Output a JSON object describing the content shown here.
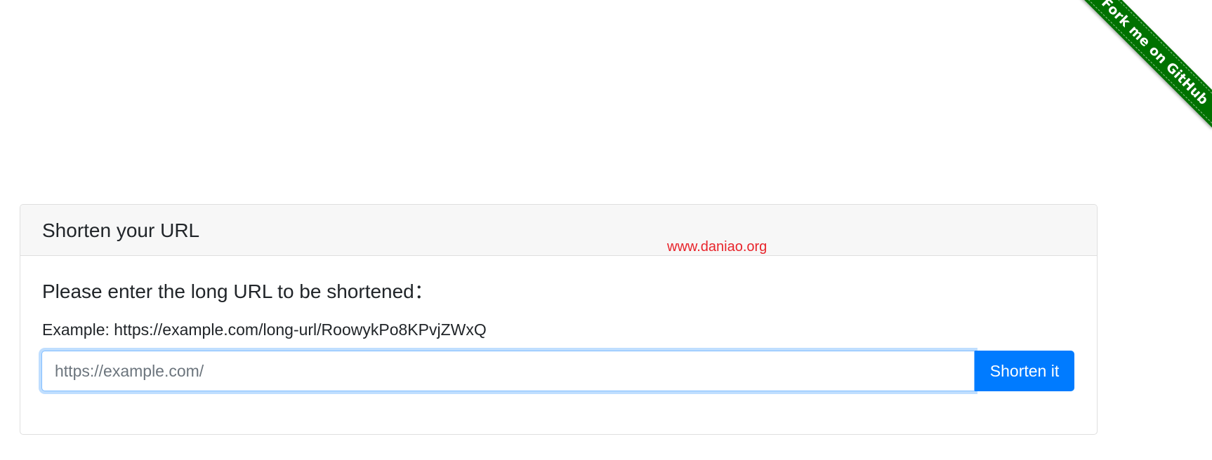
{
  "ribbon": {
    "label": "Fork me on GitHub",
    "color": "#007200"
  },
  "watermark": {
    "text": "www.daniao.org",
    "color": "#e8242b"
  },
  "card": {
    "title": "Shorten your URL",
    "prompt": "Please enter the long URL to be shortened：",
    "example": "Example: https://example.com/long-url/RoowykPo8KPvjZWxQ",
    "input": {
      "value": "",
      "placeholder": "https://example.com/"
    },
    "submit_label": "Shorten it",
    "accent_color": "#007bff"
  }
}
